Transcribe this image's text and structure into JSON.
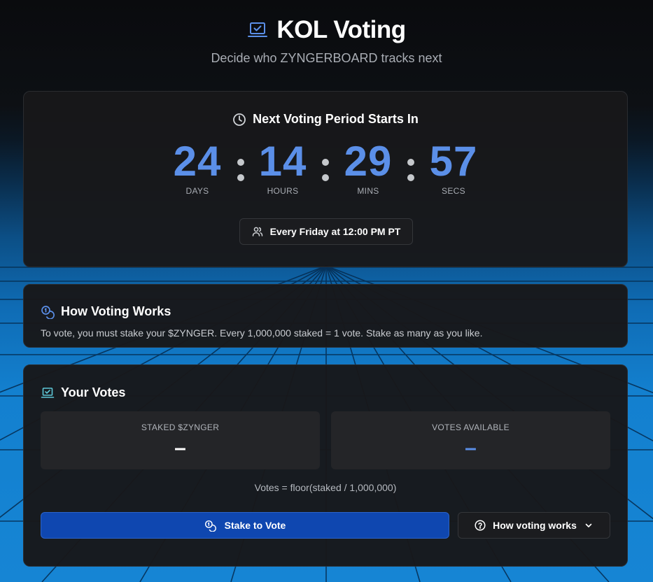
{
  "header": {
    "title": "KOL Voting",
    "subtitle": "Decide who ZYNGERBOARD tracks next",
    "title_icon": "laptop-check-icon"
  },
  "countdown": {
    "heading": "Next Voting Period Starts In",
    "heading_icon": "clock-icon",
    "units": [
      {
        "value": "24",
        "label": "DAYS"
      },
      {
        "value": "14",
        "label": "HOURS"
      },
      {
        "value": "29",
        "label": "MINS"
      },
      {
        "value": "57",
        "label": "SECS"
      }
    ],
    "schedule": "Every Friday at 12:00 PM PT",
    "schedule_icon": "users-icon"
  },
  "how_voting": {
    "heading": "How Voting Works",
    "heading_icon": "coins-icon",
    "text": "To vote, you must stake your $ZYNGER. Every 1,000,000 staked = 1 vote. Stake as many as you like."
  },
  "your_votes": {
    "heading": "Your Votes",
    "heading_icon": "laptop-check-icon",
    "staked": {
      "label": "STAKED $ZYNGER",
      "value": "–"
    },
    "available": {
      "label": "VOTES AVAILABLE",
      "value": "–"
    },
    "formula": "Votes = floor(staked / 1,000,000)",
    "stake_button": "Stake to Vote",
    "stake_button_icon": "coins-icon",
    "how_button": "How voting works",
    "how_button_icon": "help-circle-icon"
  },
  "colors": {
    "accent": "#5b8fe8",
    "button_primary": "#0f47b0",
    "card_bg": "#18181a",
    "teal_icon": "#5ec8d8"
  }
}
